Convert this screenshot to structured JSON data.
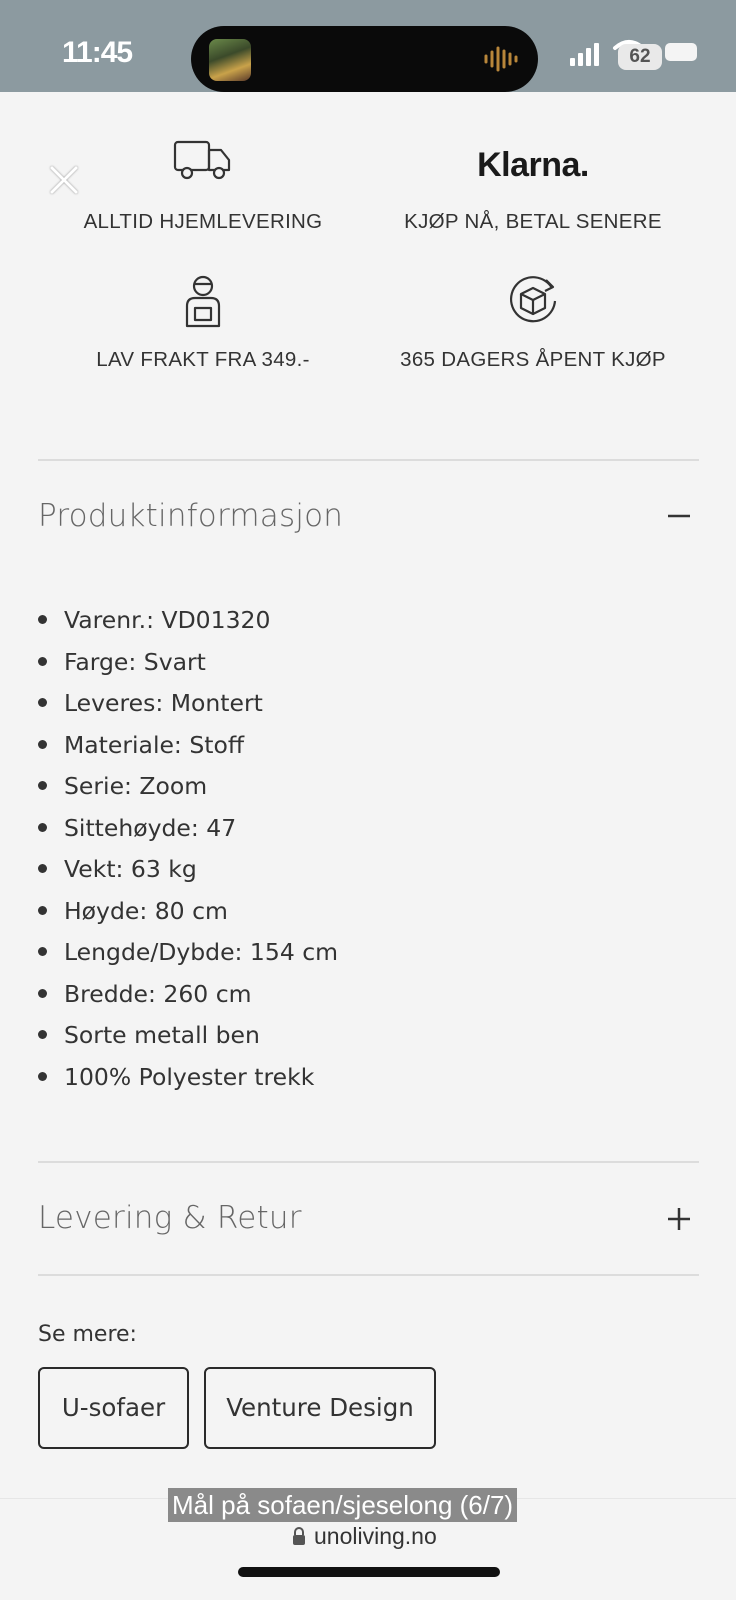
{
  "status_bar": {
    "time": "11:45",
    "battery": "62",
    "icons": [
      "album-art",
      "waveform-icon",
      "signal-icon",
      "wifi-icon",
      "battery-icon"
    ]
  },
  "features": {
    "delivery_label": "ALLTID HJEMLEVERING",
    "klarna_logo": "Klarna.",
    "klarna_label": "KJØP NÅ, BETAL SENERE",
    "shipping_label": "LAV FRAKT FRA 349.-",
    "returns_label": "365 DAGERS ÅPENT KJØP"
  },
  "product_info": {
    "title": "Produktinformasjon",
    "expanded": true,
    "specs": [
      "Varenr.: VD01320",
      "Farge: Svart",
      "Leveres: Montert",
      "Materiale: Stoff",
      "Serie: Zoom",
      "Sittehøyde: 47",
      "Vekt: 63 kg",
      "Høyde: 80 cm",
      "Lengde/Dybde: 154 cm",
      "Bredde: 260 cm",
      "Sorte metall ben",
      "100% Polyester trekk"
    ]
  },
  "delivery_return": {
    "title": "Levering & Retur",
    "expanded": false
  },
  "see_more": {
    "label": "Se mere:",
    "chips": [
      "U-sofaer",
      "Venture Design"
    ]
  },
  "caption": "Mål på sofaen/sjeselong (6/7)",
  "browser": {
    "url": "unoliving.no"
  },
  "colors": {
    "status_bar_bg": "#8c9aa0",
    "page_bg": "#f4f4f4",
    "text": "#333333"
  }
}
